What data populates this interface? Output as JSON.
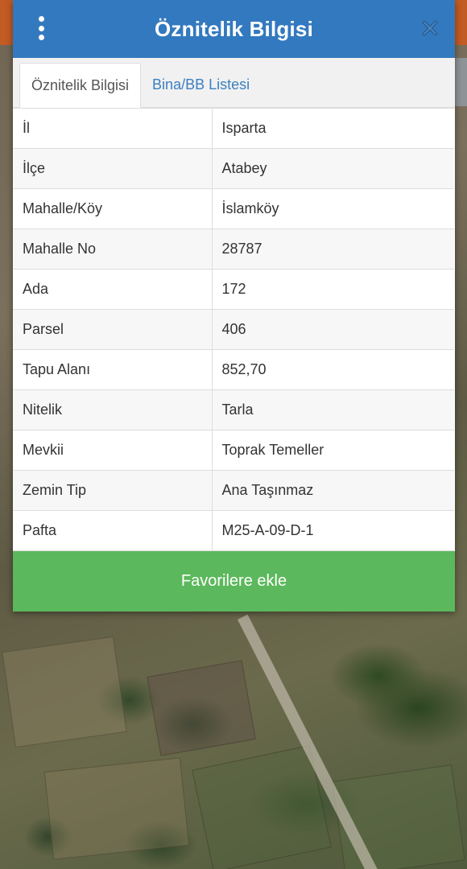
{
  "dialog": {
    "title": "Öznitelik Bilgisi",
    "header_color": "#3379bf",
    "menu_icon": "kebab-menu-icon",
    "close_icon": "close-icon"
  },
  "tabs": [
    {
      "label": "Öznitelik Bilgisi",
      "active": true
    },
    {
      "label": "Bina/BB Listesi",
      "active": false
    }
  ],
  "attributes": [
    {
      "key": "İl",
      "value": "Isparta"
    },
    {
      "key": "İlçe",
      "value": "Atabey"
    },
    {
      "key": "Mahalle/Köy",
      "value": "İslamköy"
    },
    {
      "key": "Mahalle No",
      "value": "28787"
    },
    {
      "key": "Ada",
      "value": "172"
    },
    {
      "key": "Parsel",
      "value": "406"
    },
    {
      "key": "Tapu Alanı",
      "value": "852,70"
    },
    {
      "key": "Nitelik",
      "value": "Tarla"
    },
    {
      "key": "Mevkii",
      "value": "Toprak Temeller"
    },
    {
      "key": "Zemin Tip",
      "value": "Ana Taşınmaz"
    },
    {
      "key": "Pafta",
      "value": "M25-A-09-D-1"
    }
  ],
  "actions": {
    "favorite_label": "Favorilere ekle",
    "favorite_color": "#5cb85c"
  }
}
